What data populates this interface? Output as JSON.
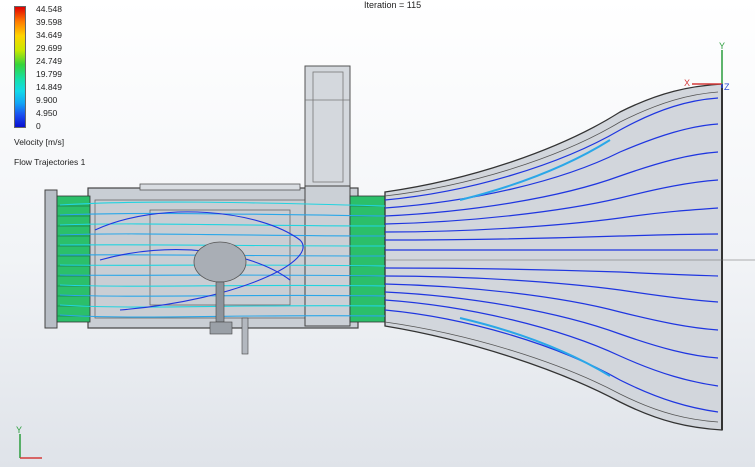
{
  "legend": {
    "values": [
      "44.548",
      "39.598",
      "34.649",
      "29.699",
      "24.749",
      "19.799",
      "14.849",
      "9.900",
      "4.950",
      "0"
    ],
    "unit": "Velocity [m/s]"
  },
  "plot_name": "Flow Trajectories 1",
  "iteration_label": "Iteration = 115",
  "triad_top": {
    "y": "Y",
    "x": "X",
    "z": "Z"
  },
  "triad_bottom": {
    "y": "Y"
  },
  "colors": {
    "stream_fast": "#1f36e0",
    "stream_mid": "#2aa7e8",
    "stream_slow": "#22d3e0",
    "honeycomb": "#2bbf6a",
    "body": "#c8cdd3"
  }
}
